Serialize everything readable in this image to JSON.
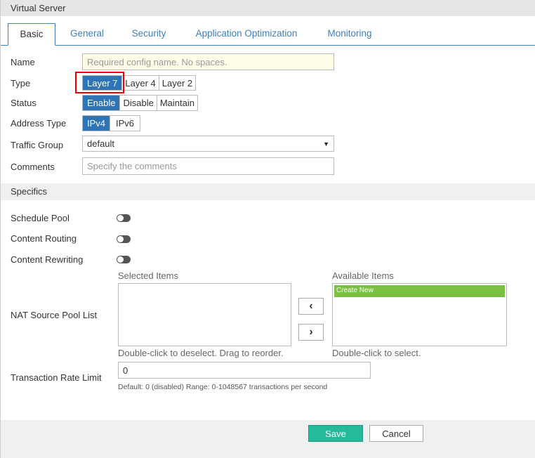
{
  "title": "Virtual Server",
  "tabs": [
    "Basic",
    "General",
    "Security",
    "Application Optimization",
    "Monitoring"
  ],
  "form": {
    "name_label": "Name",
    "name_placeholder": "Required config name. No spaces.",
    "type_label": "Type",
    "type_options": [
      "Layer 7",
      "Layer 4",
      "Layer 2"
    ],
    "status_label": "Status",
    "status_options": [
      "Enable",
      "Disable",
      "Maintain"
    ],
    "address_label": "Address Type",
    "address_options": [
      "IPv4",
      "IPv6"
    ],
    "traffic_label": "Traffic Group",
    "traffic_value": "default",
    "comments_label": "Comments",
    "comments_placeholder": "Specify the comments"
  },
  "specifics": {
    "title": "Specifics",
    "schedule_pool": "Schedule Pool",
    "content_routing": "Content Routing",
    "content_rewriting": "Content Rewriting",
    "nat_label": "NAT Source Pool List",
    "selected_label": "Selected Items",
    "available_label": "Available Items",
    "available_items": [
      "Create New"
    ],
    "selected_hint": "Double-click to deselect. Drag to reorder.",
    "available_hint": "Double-click to select.",
    "rate_label": "Transaction Rate Limit",
    "rate_value": "0",
    "rate_help": "Default: 0 (disabled) Range: 0-1048567 transactions per second"
  },
  "footer": {
    "save": "Save",
    "cancel": "Cancel"
  },
  "colors": {
    "accent": "#2f74b5",
    "save": "#26b99a",
    "highlight": "#7bc043"
  }
}
